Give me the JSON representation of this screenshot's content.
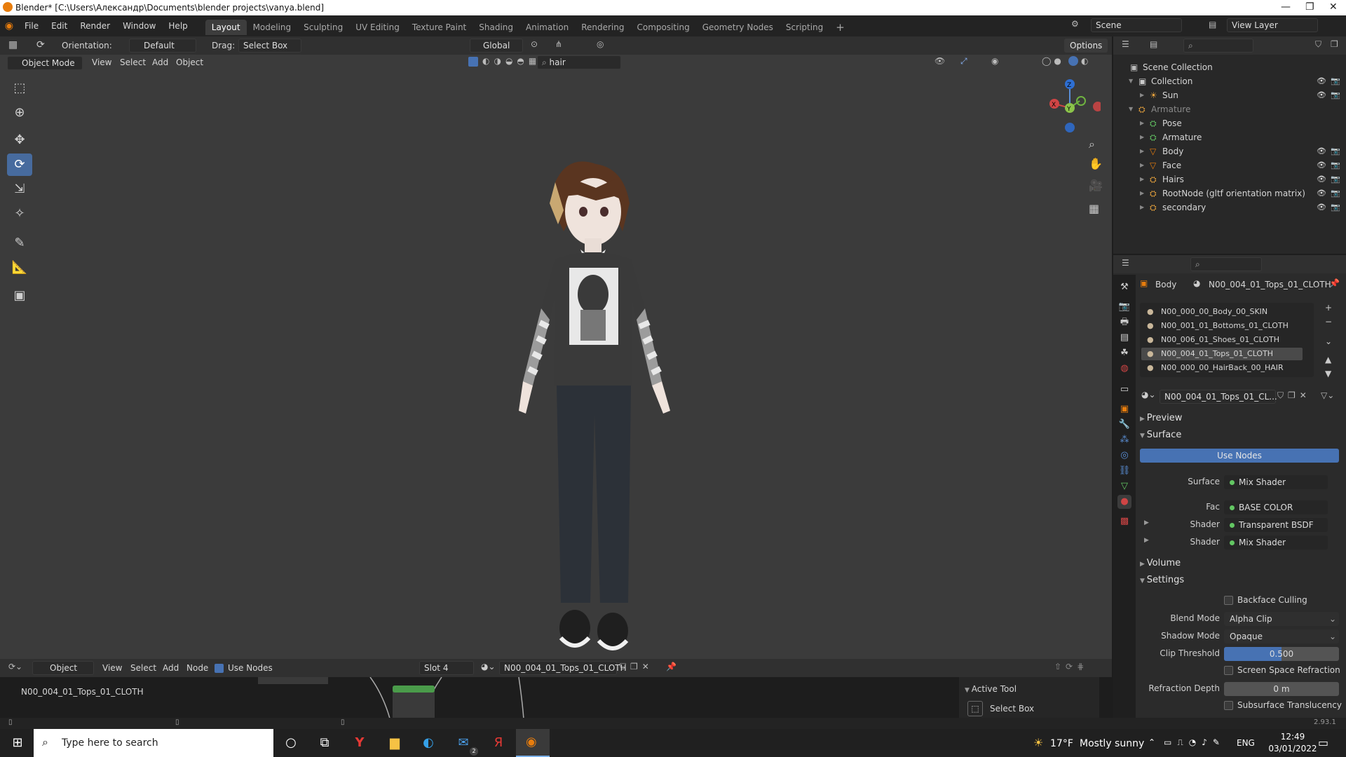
{
  "window": {
    "title": "Blender* [C:\\Users\\Александр\\Documents\\blender projects\\vanya.blend]",
    "controls": [
      "—",
      "❐",
      "✕"
    ]
  },
  "menu": {
    "items": [
      "File",
      "Edit",
      "Render",
      "Window",
      "Help"
    ],
    "workspaces": [
      "Layout",
      "Modeling",
      "Sculpting",
      "UV Editing",
      "Texture Paint",
      "Shading",
      "Animation",
      "Rendering",
      "Compositing",
      "Geometry Nodes",
      "Scripting"
    ],
    "add_workspace": "+",
    "scene": "Scene",
    "view_layer": "View Layer"
  },
  "viewport_header": {
    "orientation_label": "Orientation:",
    "orientation_value": "Default",
    "drag_label": "Drag:",
    "drag_value": "Select Box",
    "transform_orientation": "Global",
    "options": "Options",
    "mode": "Object Mode",
    "menus": [
      "View",
      "Select",
      "Add",
      "Object"
    ],
    "search_value": "hair"
  },
  "gizmo": {
    "x": "X",
    "y": "Y",
    "z": "Z"
  },
  "outliner": {
    "root": "Scene Collection",
    "rows": [
      {
        "label": "Collection",
        "level": 0,
        "expanded": true
      },
      {
        "label": "Sun",
        "level": 1
      },
      {
        "label": "Armature",
        "level": 0,
        "dim": true,
        "expanded": true
      },
      {
        "label": "Pose",
        "level": 1
      },
      {
        "label": "Armature",
        "level": 1
      },
      {
        "label": "Body",
        "level": 1
      },
      {
        "label": "Face",
        "level": 1
      },
      {
        "label": "Hairs",
        "level": 1
      },
      {
        "label": "RootNode (gltf orientation matrix)",
        "level": 1
      },
      {
        "label": "secondary",
        "level": 1
      }
    ]
  },
  "properties": {
    "breadcrumb_object": "Body",
    "breadcrumb_material": "N00_004_01_Tops_01_CLOTH",
    "slots": [
      "N00_000_00_Body_00_SKIN",
      "N00_001_01_Bottoms_01_CLOTH",
      "N00_006_01_Shoes_01_CLOTH",
      "N00_004_01_Tops_01_CLOTH",
      "N00_000_00_HairBack_00_HAIR"
    ],
    "selected_slot": 3,
    "material_name": "N00_004_01_Tops_01_CL...",
    "preview": "Preview",
    "surface_section": "Surface",
    "use_nodes": "Use Nodes",
    "surface_label": "Surface",
    "surface_value": "Mix Shader",
    "fac_label": "Fac",
    "fac_value": "BASE COLOR",
    "shader1_label": "Shader",
    "shader1_value": "Transparent BSDF",
    "shader2_label": "Shader",
    "shader2_value": "Mix Shader",
    "volume": "Volume",
    "settings": "Settings",
    "backface_culling": "Backface Culling",
    "blend_mode_label": "Blend Mode",
    "blend_mode_value": "Alpha Clip",
    "shadow_mode_label": "Shadow Mode",
    "shadow_mode_value": "Opaque",
    "clip_threshold_label": "Clip Threshold",
    "clip_threshold_value": "0.500",
    "clip_threshold_fraction": 0.5,
    "screen_space_refraction": "Screen Space Refraction",
    "refraction_depth_label": "Refraction Depth",
    "refraction_depth_value": "0 m",
    "subsurface_translucency": "Subsurface Translucency"
  },
  "node_editor": {
    "editor_type": "Object",
    "menus": [
      "View",
      "Select",
      "Add",
      "Node"
    ],
    "use_nodes": "Use Nodes",
    "slot": "Slot 4",
    "material": "N00_004_01_Tops_01_CLOTH",
    "breadcrumb": "N00_004_01_Tops_01_CLOTH",
    "active_tool_title": "Active Tool",
    "active_tool_value": "Select Box"
  },
  "version": "2.93.1",
  "taskbar": {
    "search_placeholder": "Type here to search",
    "weather_temp": "17°F",
    "weather_text": "Mostly sunny",
    "language": "ENG",
    "time": "12:49",
    "date": "03/01/2022",
    "mail_badge": "2"
  },
  "colors": {
    "accent": "#4772b3",
    "active_tab": "#476b9e",
    "viewport_bg": "#3b3b3b"
  }
}
